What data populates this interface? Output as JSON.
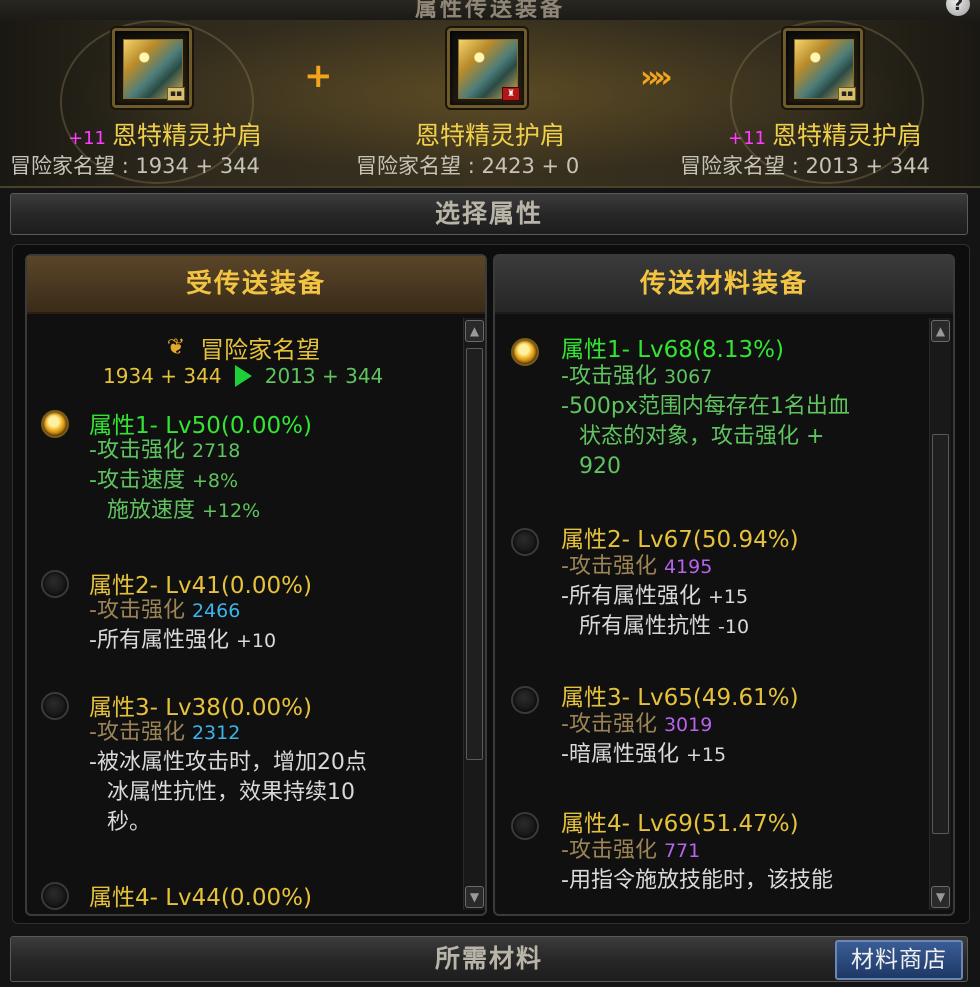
{
  "window": {
    "title": "属性传送装备",
    "help_icon": "question-icon"
  },
  "transfer": {
    "plus_symbol": "+",
    "arrow_symbol": "»»",
    "target": {
      "level": "+11",
      "name": "恩特精灵护肩",
      "reputation_label": "冒险家名望",
      "reputation_value": ": 1934 + 344"
    },
    "material": {
      "level": "",
      "name": "恩特精灵护肩",
      "reputation_label": "冒险家名望",
      "reputation_value": ": 2423 + 0"
    },
    "result": {
      "level": "+11",
      "name": "恩特精灵护肩",
      "reputation_label": "冒险家名望",
      "reputation_value": ": 2013 + 344"
    }
  },
  "select_section_label": "选择属性",
  "left_panel": {
    "title": "受传送装备",
    "reputation": {
      "label": "冒险家名望",
      "before": "1934 + 344",
      "after": "2013 + 344"
    },
    "options": [
      {
        "title": "属性1- Lv50(0.00%)",
        "selected": true,
        "lines": [
          {
            "text": "-攻击强化",
            "value": "2718"
          },
          {
            "text": "-攻击速度",
            "value": "+8%"
          },
          {
            "text": " 施放速度",
            "value": "+12%"
          }
        ]
      },
      {
        "title": "属性2- Lv41(0.00%)",
        "selected": false,
        "lines": [
          {
            "text": "-攻击强化",
            "value": "2466"
          },
          {
            "text": "-所有属性强化",
            "value": "+10"
          }
        ]
      },
      {
        "title": "属性3- Lv38(0.00%)",
        "selected": false,
        "lines": [
          {
            "text": "-攻击强化",
            "value": "2312"
          },
          {
            "text": "-被冰属性攻击时，增加20点"
          },
          {
            "text": " 冰属性抗性，效果持续10"
          },
          {
            "text": " 秒。"
          }
        ]
      },
      {
        "title": "属性4- Lv44(0.00%)",
        "selected": false,
        "lines": []
      }
    ]
  },
  "right_panel": {
    "title": "传送材料装备",
    "options": [
      {
        "title": "属性1- Lv68(8.13%)",
        "selected": true,
        "lines": [
          {
            "text": "-攻击强化",
            "value": "3067"
          },
          {
            "text": "-500px范围内每存在1名出血"
          },
          {
            "text": " 状态的对象，攻击强化 +"
          },
          {
            "text": " 920"
          }
        ]
      },
      {
        "title": "属性2- Lv67(50.94%)",
        "selected": false,
        "lines": [
          {
            "text": "-攻击强化",
            "value": "4195"
          },
          {
            "text": "-所有属性强化",
            "value": "+15"
          },
          {
            "text": " 所有属性抗性",
            "value": "-10"
          }
        ]
      },
      {
        "title": "属性3- Lv65(49.61%)",
        "selected": false,
        "lines": [
          {
            "text": "-攻击强化",
            "value": "3019"
          },
          {
            "text": "-暗属性强化",
            "value": "+15"
          }
        ]
      },
      {
        "title": "属性4- Lv69(51.47%)",
        "selected": false,
        "lines": [
          {
            "text": "-攻击强化",
            "value": "771"
          },
          {
            "text": "-用指令施放技能时，该技能"
          }
        ]
      }
    ]
  },
  "materials_section_label": "所需材料",
  "shop_button_label": "材料商店",
  "colors": {
    "selected_title": "#33e533",
    "title": "#e6c23c",
    "accent": "#f2a51a",
    "plus_level": "#ff3cff",
    "value_cyan": "#3ab6ee",
    "value_purple": "#b664ee"
  }
}
